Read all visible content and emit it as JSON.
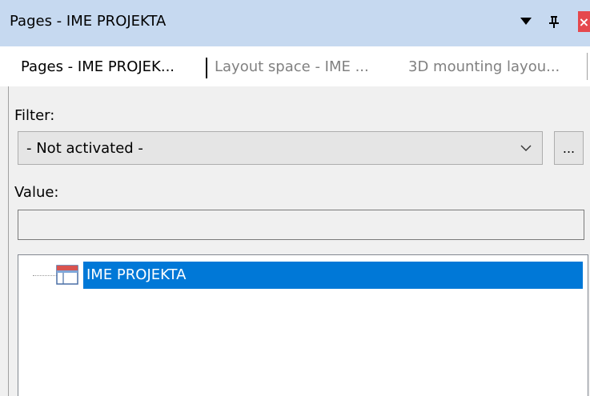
{
  "window": {
    "title": "Pages - IME PROJEKTA",
    "close_glyph": "×"
  },
  "tabs": [
    {
      "label": "Pages - IME PROJEK...",
      "active": true
    },
    {
      "label": "Layout space - IME ...",
      "active": false
    },
    {
      "label": "3D mounting layou...",
      "active": false
    }
  ],
  "filter": {
    "label": "Filter:",
    "selected": "- Not activated -",
    "browse_label": "..."
  },
  "value": {
    "label": "Value:",
    "text": ""
  },
  "tree": {
    "items": [
      {
        "label": "IME PROJEKTA",
        "icon": "project-icon",
        "selected": true
      }
    ]
  },
  "colors": {
    "titlebar_bg": "#c6d9f0",
    "selection": "#0078d7",
    "close_red": "#e5484d"
  }
}
